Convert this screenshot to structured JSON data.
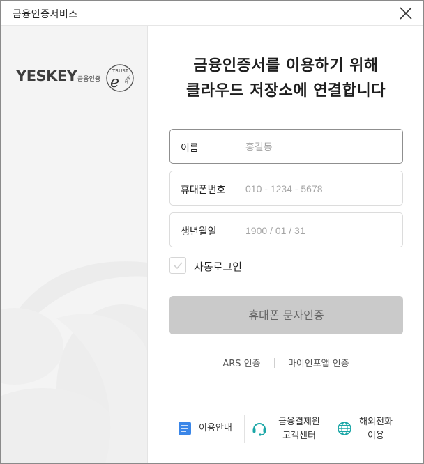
{
  "window": {
    "title": "금융인증서비스"
  },
  "brand": {
    "logo_text": "YESKEY",
    "logo_sub": "금융인증",
    "esign_top": "TRUST",
    "esign_letter": "e",
    "esign_side": "Sign"
  },
  "heading": {
    "line1": "금융인증서를 이용하기 위해",
    "line2": "클라우드 저장소에 연결합니다"
  },
  "form": {
    "name": {
      "label": "이름",
      "placeholder": "홍길동",
      "value": ""
    },
    "phone": {
      "label": "휴대폰번호",
      "placeholder": "010 - 1234 - 5678",
      "value": ""
    },
    "birth": {
      "label": "생년월일",
      "placeholder": "1900 / 01 / 31",
      "value": ""
    },
    "auto_login": {
      "label": "자동로그인",
      "checked": false
    }
  },
  "buttons": {
    "sms": "휴대폰 문자인증"
  },
  "alt_auth": {
    "ars": "ARS 인증",
    "app": "마이인포앱 인증"
  },
  "footer": {
    "guide": "이용안내",
    "support_line1": "금융결제원",
    "support_line2": "고객센터",
    "overseas_line1": "해외전화",
    "overseas_line2": "이용"
  },
  "colors": {
    "accent_blue": "#3a86e8",
    "teal": "#1aa6a6",
    "button_disabled": "#cacaca"
  },
  "icons": {
    "close": "close-icon",
    "checkbox": "check-icon",
    "guide": "document-icon",
    "support": "headset-icon",
    "overseas": "globe-icon"
  }
}
